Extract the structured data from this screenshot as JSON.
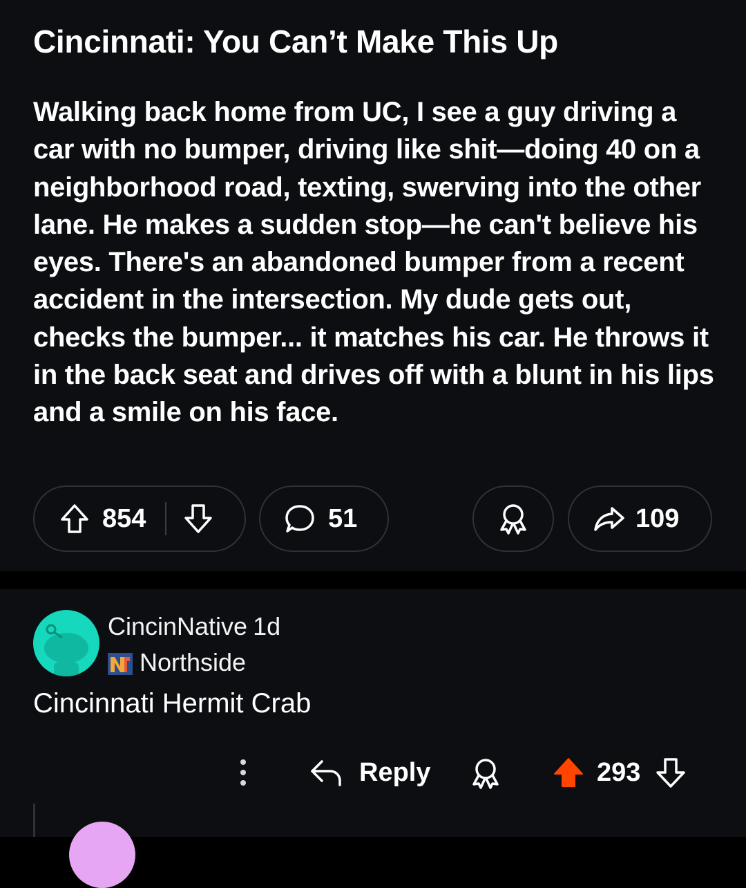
{
  "post": {
    "title": "Cincinnati: You Can’t Make This Up",
    "body": "Walking back home from UC, I see a guy driving a car with no bumper, driving like shit—doing 40 on a neighborhood road, texting, swerving into the other lane. He makes a sudden stop—he can't believe his eyes. There's an abandoned bumper from a recent accident in the intersection. My dude gets out, checks the bumper... it matches his car. He throws it in the back seat and drives off with a blunt in his lips and a smile on his face.",
    "upvotes": "854",
    "comments": "51",
    "shares": "109",
    "icons": {
      "upvote": "upvote-arrow-icon",
      "downvote": "downvote-arrow-icon",
      "comment": "comment-bubble-icon",
      "award": "award-icon",
      "share": "share-arrow-icon"
    }
  },
  "comment": {
    "username": "CincinNative",
    "age": "1d",
    "flair": "Northside",
    "text": "Cincinnati Hermit Crab",
    "reply_label": "Reply",
    "score": "293",
    "colors": {
      "avatar": "#16d8bd",
      "upvote_active": "#ff4500"
    }
  },
  "colors": {
    "background": "#0c0e11",
    "divider": "#000000",
    "pill_border": "#2e3236",
    "text": "#ffffff"
  }
}
